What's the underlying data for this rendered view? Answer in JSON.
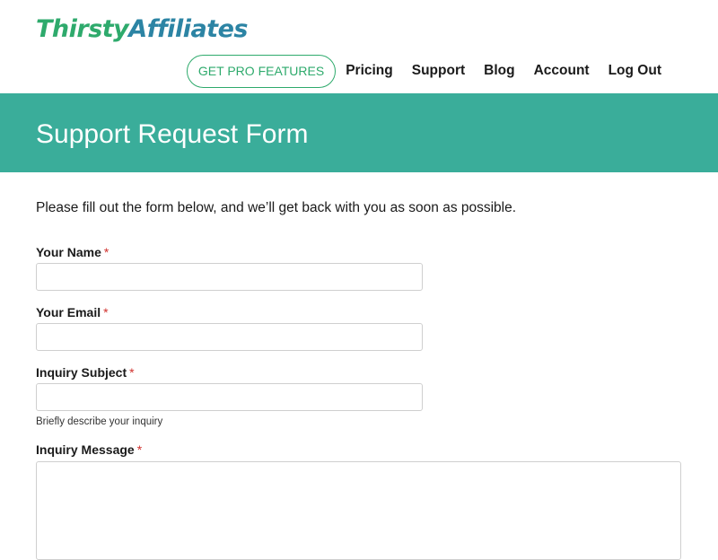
{
  "header": {
    "logo": {
      "part1": "Thirsty",
      "part2": "Affiliates",
      "colors": {
        "part1": "#2eaa6c",
        "part2": "#2c84a4"
      }
    },
    "nav": {
      "pro_button": "GET PRO FEATURES",
      "links": [
        "Pricing",
        "Support",
        "Blog",
        "Account",
        "Log Out"
      ]
    }
  },
  "banner": {
    "title": "Support Request Form",
    "background": "#3aad9a"
  },
  "form": {
    "intro": "Please fill out the form below, and we’ll get back with you as soon as possible.",
    "required_marker": "*",
    "fields": [
      {
        "label": "Your Name",
        "value": "",
        "placeholder": ""
      },
      {
        "label": "Your Email",
        "value": "",
        "placeholder": ""
      },
      {
        "label": "Inquiry Subject",
        "value": "",
        "placeholder": "",
        "help": "Briefly describe your inquiry"
      },
      {
        "label": "Inquiry Message",
        "value": "",
        "placeholder": ""
      }
    ]
  },
  "colors": {
    "accent": "#2eaa6c",
    "required": "#d0312d"
  }
}
